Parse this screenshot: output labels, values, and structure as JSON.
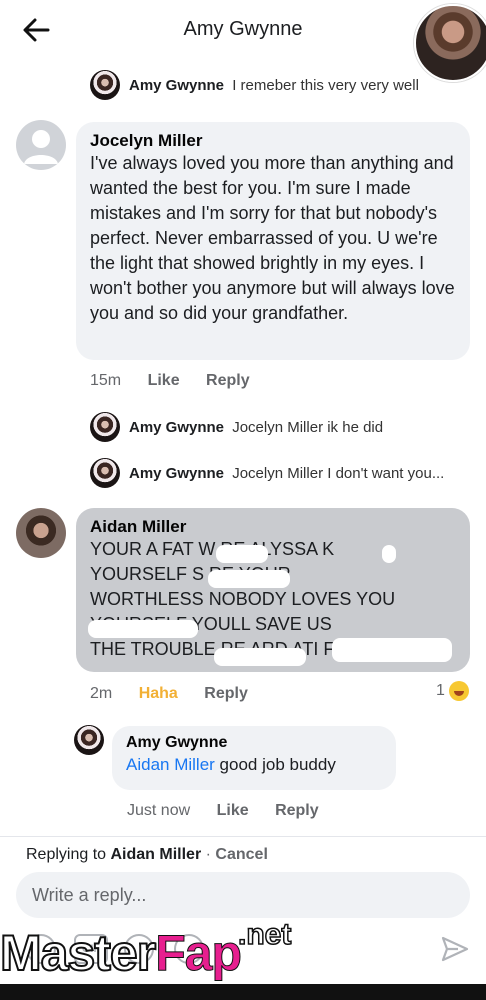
{
  "header": {
    "title": "Amy Gwynne",
    "back_icon": "arrow-left-icon"
  },
  "thread": {
    "reply_top": {
      "name": "Amy Gwynne",
      "text": "I remeber this very very well"
    },
    "comment_jocelyn": {
      "name": "Jocelyn Miller",
      "text": "I've always loved you more than anything and wanted the best for you. I'm sure I made mistakes and I'm sorry for that but nobody's perfect. Never embarrassed of you. U we're the light that showed brightly in my eyes. I won't bother you anymore but will always love you and so did your grandfather.",
      "time": "15m",
      "like": "Like",
      "reply": "Reply"
    },
    "reply_2": {
      "name": "Amy Gwynne",
      "text": "Jocelyn Miller ik he did"
    },
    "reply_3": {
      "name": "Amy Gwynne",
      "text": "Jocelyn Miller I don't want you..."
    },
    "comment_aidan": {
      "name": "Aidan Miller",
      "lines": [
        "YOUR A FAT W  RE ALYSSA K",
        "YOURSELF S        RE YOUR",
        "WORTHLESS NOBODY LOVES YOU",
        "          YOURSELF YOULL SAVE US",
        "THE TROUBLE RE  ARD ATI    FA"
      ],
      "time": "2m",
      "reaction_label": "Haha",
      "reply": "Reply",
      "reaction_count": "1"
    },
    "reply_4": {
      "name": "Amy Gwynne",
      "mention": "Aidan Miller",
      "text": "good job buddy",
      "time": "Just now",
      "like": "Like",
      "reply": "Reply"
    }
  },
  "reply_bar": {
    "replying_label": "Replying to",
    "replying_name": "Aidan Miller",
    "separator": "·",
    "cancel": "Cancel",
    "placeholder": "Write a reply...",
    "gif_label": "GIF"
  },
  "watermark": {
    "part1": "Master",
    "part2": "Fap",
    "suffix": ".net"
  },
  "colors": {
    "mention": "#1877f2",
    "haha": "#f2b035",
    "meta": "#65676b"
  }
}
